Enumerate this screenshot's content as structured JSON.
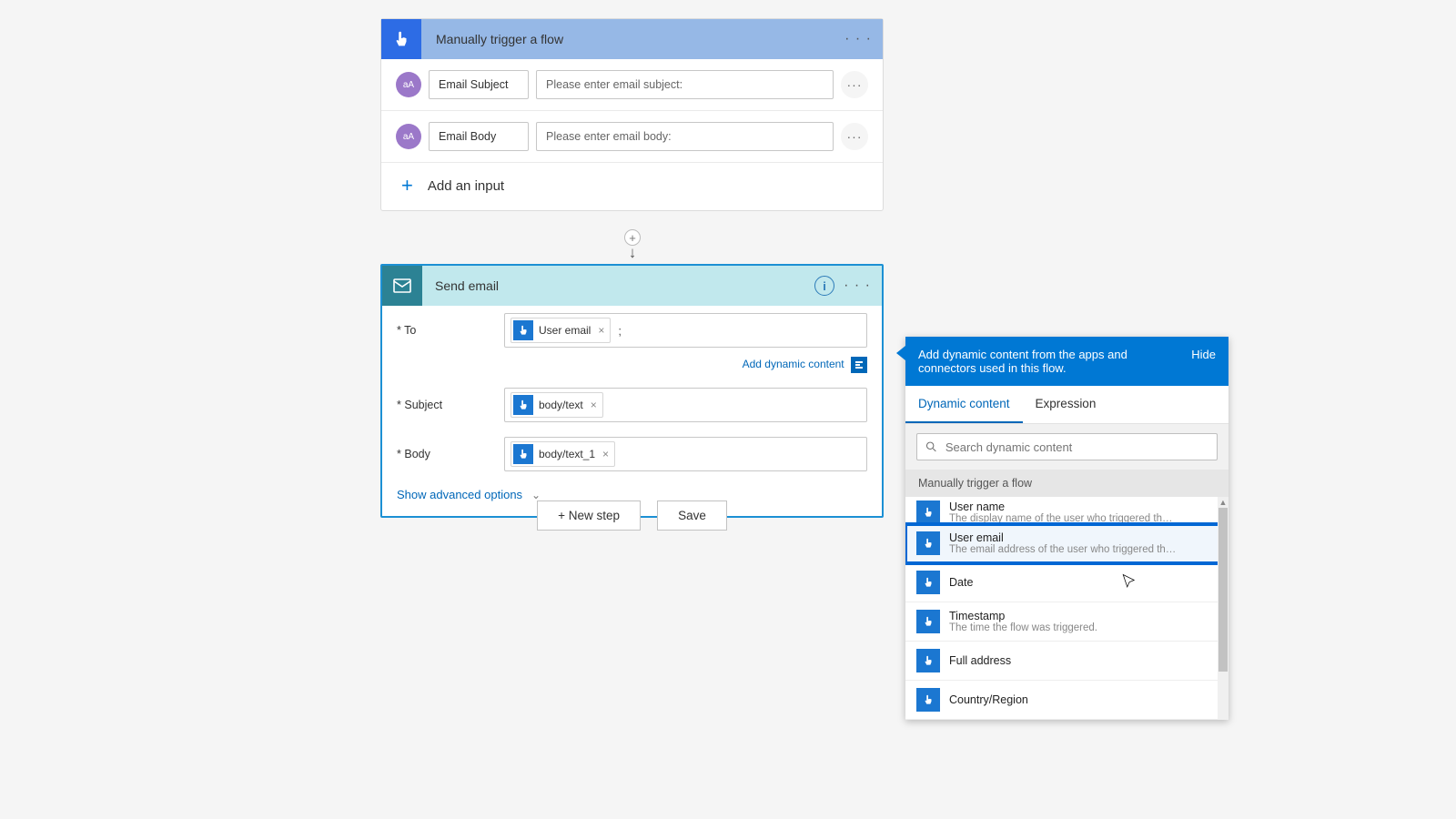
{
  "trigger": {
    "title": "Manually trigger a flow",
    "inputs": [
      {
        "avatar": "aA",
        "name": "Email Subject",
        "placeholder": "Please enter email subject:"
      },
      {
        "avatar": "aA",
        "name": "Email Body",
        "placeholder": "Please enter email body:"
      }
    ],
    "add_input": "Add an input"
  },
  "action": {
    "title": "Send email",
    "fields": {
      "to_label": "To",
      "to_token": "User email",
      "subject_label": "Subject",
      "subject_token": "body/text",
      "body_label": "Body",
      "body_token": "body/text_1"
    },
    "add_dynamic": "Add dynamic content",
    "advanced": "Show advanced options"
  },
  "buttons": {
    "new_step": "+ New step",
    "save": "Save"
  },
  "panel": {
    "header_text": "Add dynamic content from the apps and connectors used in this flow.",
    "hide": "Hide",
    "tab_dynamic": "Dynamic content",
    "tab_expression": "Expression",
    "search_placeholder": "Search dynamic content",
    "section_title": "Manually trigger a flow",
    "items": [
      {
        "title": "User name",
        "desc": "The display name of the user who triggered the flow"
      },
      {
        "title": "User email",
        "desc": "The email address of the user who triggered the flow."
      },
      {
        "title": "Date",
        "desc": ""
      },
      {
        "title": "Timestamp",
        "desc": "The time the flow was triggered."
      },
      {
        "title": "Full address",
        "desc": ""
      },
      {
        "title": "Country/Region",
        "desc": ""
      }
    ]
  }
}
